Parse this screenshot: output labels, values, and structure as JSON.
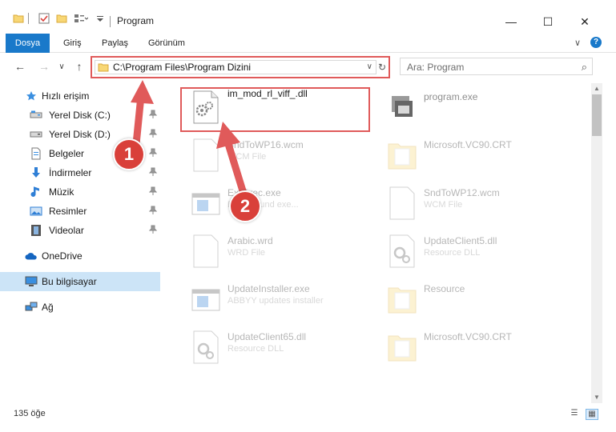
{
  "window": {
    "title": "Program",
    "minimize_glyph": "—",
    "maximize_glyph": "☐",
    "close_glyph": "✕"
  },
  "ribbon": {
    "tabs": [
      "Dosya",
      "Giriş",
      "Paylaş",
      "Görünüm"
    ],
    "expand_glyph": "∨",
    "help_glyph": "?"
  },
  "navigation": {
    "back_glyph": "←",
    "forward_glyph": "→",
    "recent_glyph": "∨",
    "up_glyph": "↑",
    "address": "C:\\Program Files\\Program Dizini",
    "dropdown_glyph": "∨",
    "refresh_glyph": "↻",
    "search_placeholder": "Ara: Program",
    "search_glyph": "⌕"
  },
  "sidebar": {
    "items": [
      {
        "label": "Hızlı erişim",
        "icon": "star-icon",
        "pinned": false
      },
      {
        "label": "Yerel Disk (C:)",
        "icon": "drive-icon",
        "pinned": true
      },
      {
        "label": "Yerel Disk (D:)",
        "icon": "drive-icon",
        "pinned": true
      },
      {
        "label": "Belgeler",
        "icon": "document-icon",
        "pinned": true
      },
      {
        "label": "İndirmeler",
        "icon": "download-icon",
        "pinned": true
      },
      {
        "label": "Müzik",
        "icon": "music-icon",
        "pinned": true
      },
      {
        "label": "Resimler",
        "icon": "picture-icon",
        "pinned": true
      },
      {
        "label": "Videolar",
        "icon": "video-icon",
        "pinned": true
      },
      {
        "label": "OneDrive",
        "icon": "cloud-icon",
        "pinned": false
      },
      {
        "label": "Bu bilgisayar",
        "icon": "computer-icon",
        "pinned": false
      },
      {
        "label": "Ağ",
        "icon": "network-icon",
        "pinned": false
      }
    ],
    "pin_glyph": "📌"
  },
  "files": [
    {
      "name": "im_mod_rl_viff_.dll",
      "sub": "",
      "icon": "dll-gear-icon"
    },
    {
      "name": "program.exe",
      "sub": "",
      "icon": "exe-icon"
    },
    {
      "name": "SndToWP16.wcm",
      "sub": "WCM File",
      "icon": "blank-file-icon"
    },
    {
      "name": "Microsoft.VC90.CRT",
      "sub": "",
      "icon": "folder-icon"
    },
    {
      "name": "ExtExec.exe",
      "sub": "Background exe...",
      "icon": "exe-window-icon"
    },
    {
      "name": "SndToWP12.wcm",
      "sub": "WCM File",
      "icon": "blank-file-icon"
    },
    {
      "name": "Arabic.wrd",
      "sub": "WRD File",
      "icon": "blank-file-icon"
    },
    {
      "name": "UpdateClient5.dll",
      "sub": "Resource DLL",
      "icon": "dll-gear-icon"
    },
    {
      "name": "UpdateInstaller.exe",
      "sub": "ABBYY updates installer",
      "icon": "exe-window-icon"
    },
    {
      "name": "Resource",
      "sub": "",
      "icon": "folder-icon"
    },
    {
      "name": "UpdateClient65.dll",
      "sub": "Resource DLL",
      "icon": "dll-gear-icon"
    },
    {
      "name": "Microsoft.VC90.CRT",
      "sub": "",
      "icon": "folder-icon"
    }
  ],
  "scrollbar": {
    "up_glyph": "▲",
    "down_glyph": "▼"
  },
  "status": {
    "count": "135 öğe",
    "details_view_glyph": "☰",
    "icons_view_glyph": "▦"
  },
  "callouts": {
    "one": "1",
    "two": "2"
  },
  "colors": {
    "accent": "#1979ca",
    "highlight_red": "#e05a5a",
    "callout_red": "#d9403a",
    "selected_bg": "#cce4f7"
  }
}
